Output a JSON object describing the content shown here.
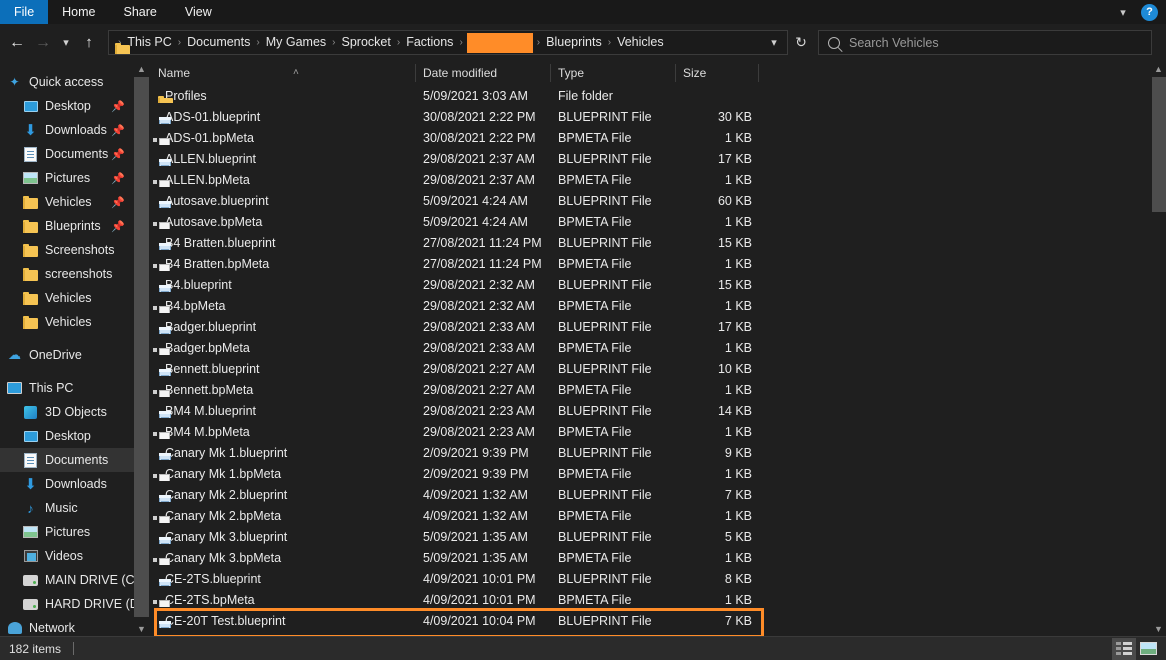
{
  "titlebar": {
    "tabs": [
      {
        "label": "File",
        "active": true
      },
      {
        "label": "Home",
        "active": false
      },
      {
        "label": "Share",
        "active": false
      },
      {
        "label": "View",
        "active": false
      }
    ],
    "ribbon_expand_icon": "chevron-down-icon",
    "help_label": "?"
  },
  "nav": {
    "back_icon": "arrow-left-icon",
    "forward_icon": "arrow-right-icon",
    "recent_icon": "chevron-down-icon",
    "up_icon": "arrow-up-icon",
    "refresh_icon": "refresh-icon",
    "breadcrumbs": [
      {
        "label": "This PC",
        "redacted": false
      },
      {
        "label": "Documents",
        "redacted": false
      },
      {
        "label": "My Games",
        "redacted": false
      },
      {
        "label": "Sprocket",
        "redacted": false
      },
      {
        "label": "Factions",
        "redacted": false
      },
      {
        "label": "",
        "redacted": true
      },
      {
        "label": "Blueprints",
        "redacted": false
      },
      {
        "label": "Vehicles",
        "redacted": false
      }
    ],
    "separator": "›"
  },
  "search": {
    "icon": "search-icon",
    "placeholder": "Search Vehicles",
    "value": ""
  },
  "sidebar": {
    "groups": [
      {
        "header": {
          "label": "Quick access",
          "icon": "star-pin-icon"
        },
        "items": [
          {
            "label": "Desktop",
            "icon": "desktop-icon",
            "pinned": true
          },
          {
            "label": "Downloads",
            "icon": "download-icon",
            "pinned": true
          },
          {
            "label": "Documents",
            "icon": "documents-icon",
            "pinned": true
          },
          {
            "label": "Pictures",
            "icon": "pictures-icon",
            "pinned": true
          },
          {
            "label": "Vehicles",
            "icon": "folder-icon",
            "pinned": true
          },
          {
            "label": "Blueprints",
            "icon": "folder-icon",
            "pinned": true
          },
          {
            "label": "Screenshots",
            "icon": "folder-icon",
            "pinned": false
          },
          {
            "label": "screenshots",
            "icon": "folder-icon",
            "pinned": false
          },
          {
            "label": "Vehicles",
            "icon": "folder-icon",
            "pinned": false
          },
          {
            "label": "Vehicles",
            "icon": "folder-icon",
            "pinned": false
          }
        ]
      },
      {
        "header": {
          "label": "OneDrive",
          "icon": "cloud-icon"
        },
        "items": []
      },
      {
        "header": {
          "label": "This PC",
          "icon": "computer-icon"
        },
        "items": [
          {
            "label": "3D Objects",
            "icon": "cube-icon",
            "selected": false
          },
          {
            "label": "Desktop",
            "icon": "desktop-icon",
            "selected": false
          },
          {
            "label": "Documents",
            "icon": "documents-icon",
            "selected": true
          },
          {
            "label": "Downloads",
            "icon": "download-icon",
            "selected": false
          },
          {
            "label": "Music",
            "icon": "music-icon",
            "selected": false
          },
          {
            "label": "Pictures",
            "icon": "pictures-icon",
            "selected": false
          },
          {
            "label": "Videos",
            "icon": "video-icon",
            "selected": false
          },
          {
            "label": "MAIN DRIVE (C:)",
            "icon": "drive-icon",
            "selected": false
          },
          {
            "label": "HARD DRIVE (D:)",
            "icon": "drive-icon",
            "selected": false
          }
        ]
      },
      {
        "header": {
          "label": "Network",
          "icon": "network-icon"
        },
        "items": []
      }
    ]
  },
  "filelist": {
    "columns": [
      {
        "label": "Name",
        "sorted": "asc"
      },
      {
        "label": "Date modified",
        "sorted": ""
      },
      {
        "label": "Type",
        "sorted": ""
      },
      {
        "label": "Size",
        "sorted": ""
      }
    ],
    "sort_caret": "˄",
    "rows": [
      {
        "name": "Profiles",
        "date": "5/09/2021 3:03 AM",
        "type": "File folder",
        "size": "",
        "icon": "folder-icon",
        "highlight": false
      },
      {
        "name": "ADS-01.blueprint",
        "date": "30/08/2021 2:22 PM",
        "type": "BLUEPRINT File",
        "size": "30 KB",
        "icon": "blueprint-icon",
        "highlight": false
      },
      {
        "name": "ADS-01.bpMeta",
        "date": "30/08/2021 2:22 PM",
        "type": "BPMETA File",
        "size": "1 KB",
        "icon": "bpmeta-icon",
        "highlight": false
      },
      {
        "name": "ALLEN.blueprint",
        "date": "29/08/2021 2:37 AM",
        "type": "BLUEPRINT File",
        "size": "17 KB",
        "icon": "blueprint-icon",
        "highlight": false
      },
      {
        "name": "ALLEN.bpMeta",
        "date": "29/08/2021 2:37 AM",
        "type": "BPMETA File",
        "size": "1 KB",
        "icon": "bpmeta-icon",
        "highlight": false
      },
      {
        "name": "Autosave.blueprint",
        "date": "5/09/2021 4:24 AM",
        "type": "BLUEPRINT File",
        "size": "60 KB",
        "icon": "blueprint-icon",
        "highlight": false
      },
      {
        "name": "Autosave.bpMeta",
        "date": "5/09/2021 4:24 AM",
        "type": "BPMETA File",
        "size": "1 KB",
        "icon": "bpmeta-icon",
        "highlight": false
      },
      {
        "name": "B4 Bratten.blueprint",
        "date": "27/08/2021 11:24 PM",
        "type": "BLUEPRINT File",
        "size": "15 KB",
        "icon": "blueprint-icon",
        "highlight": false
      },
      {
        "name": "B4 Bratten.bpMeta",
        "date": "27/08/2021 11:24 PM",
        "type": "BPMETA File",
        "size": "1 KB",
        "icon": "bpmeta-icon",
        "highlight": false
      },
      {
        "name": "B4.blueprint",
        "date": "29/08/2021 2:32 AM",
        "type": "BLUEPRINT File",
        "size": "15 KB",
        "icon": "blueprint-icon",
        "highlight": false
      },
      {
        "name": "B4.bpMeta",
        "date": "29/08/2021 2:32 AM",
        "type": "BPMETA File",
        "size": "1 KB",
        "icon": "bpmeta-icon",
        "highlight": false
      },
      {
        "name": "Badger.blueprint",
        "date": "29/08/2021 2:33 AM",
        "type": "BLUEPRINT File",
        "size": "17 KB",
        "icon": "blueprint-icon",
        "highlight": false
      },
      {
        "name": "Badger.bpMeta",
        "date": "29/08/2021 2:33 AM",
        "type": "BPMETA File",
        "size": "1 KB",
        "icon": "bpmeta-icon",
        "highlight": false
      },
      {
        "name": "Bennett.blueprint",
        "date": "29/08/2021 2:27 AM",
        "type": "BLUEPRINT File",
        "size": "10 KB",
        "icon": "blueprint-icon",
        "highlight": false
      },
      {
        "name": "Bennett.bpMeta",
        "date": "29/08/2021 2:27 AM",
        "type": "BPMETA File",
        "size": "1 KB",
        "icon": "bpmeta-icon",
        "highlight": false
      },
      {
        "name": "BM4 M.blueprint",
        "date": "29/08/2021 2:23 AM",
        "type": "BLUEPRINT File",
        "size": "14 KB",
        "icon": "blueprint-icon",
        "highlight": false
      },
      {
        "name": "BM4 M.bpMeta",
        "date": "29/08/2021 2:23 AM",
        "type": "BPMETA File",
        "size": "1 KB",
        "icon": "bpmeta-icon",
        "highlight": false
      },
      {
        "name": "Canary Mk 1.blueprint",
        "date": "2/09/2021 9:39 PM",
        "type": "BLUEPRINT File",
        "size": "9 KB",
        "icon": "blueprint-icon",
        "highlight": false
      },
      {
        "name": "Canary Mk 1.bpMeta",
        "date": "2/09/2021 9:39 PM",
        "type": "BPMETA File",
        "size": "1 KB",
        "icon": "bpmeta-icon",
        "highlight": false
      },
      {
        "name": "Canary Mk 2.blueprint",
        "date": "4/09/2021 1:32 AM",
        "type": "BLUEPRINT File",
        "size": "7 KB",
        "icon": "blueprint-icon",
        "highlight": false
      },
      {
        "name": "Canary Mk 2.bpMeta",
        "date": "4/09/2021 1:32 AM",
        "type": "BPMETA File",
        "size": "1 KB",
        "icon": "bpmeta-icon",
        "highlight": false
      },
      {
        "name": "Canary Mk 3.blueprint",
        "date": "5/09/2021 1:35 AM",
        "type": "BLUEPRINT File",
        "size": "5 KB",
        "icon": "blueprint-icon",
        "highlight": false
      },
      {
        "name": "Canary Mk 3.bpMeta",
        "date": "5/09/2021 1:35 AM",
        "type": "BPMETA File",
        "size": "1 KB",
        "icon": "bpmeta-icon",
        "highlight": false
      },
      {
        "name": "CE-2TS.blueprint",
        "date": "4/09/2021 10:01 PM",
        "type": "BLUEPRINT File",
        "size": "8 KB",
        "icon": "blueprint-icon",
        "highlight": false
      },
      {
        "name": "CE-2TS.bpMeta",
        "date": "4/09/2021 10:01 PM",
        "type": "BPMETA File",
        "size": "1 KB",
        "icon": "bpmeta-icon",
        "highlight": false
      },
      {
        "name": "CE-20T Test.blueprint",
        "date": "4/09/2021 10:04 PM",
        "type": "BLUEPRINT File",
        "size": "7 KB",
        "icon": "blueprint-icon",
        "highlight": true
      }
    ]
  },
  "statusbar": {
    "item_count": "182 items",
    "view_details_icon": "details-view-icon",
    "view_thumbnails_icon": "thumbnails-view-icon"
  },
  "colors": {
    "accent_blue": "#0c6fba",
    "highlight_orange": "#ff8c28",
    "background": "#1f1f1f",
    "statusbar": "#2b2b2b"
  }
}
